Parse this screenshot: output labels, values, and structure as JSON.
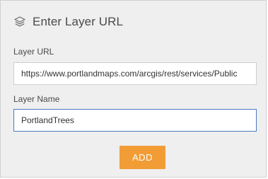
{
  "header": {
    "icon": "layers-icon",
    "title": "Enter Layer URL"
  },
  "form": {
    "url_label": "Layer URL",
    "url_value": "https://www.portlandmaps.com/arcgis/rest/services/Public",
    "name_label": "Layer Name",
    "name_value": "PortlandTrees"
  },
  "actions": {
    "add_label": "ADD"
  },
  "colors": {
    "panel_bg": "#efefef",
    "accent": "#f29c36",
    "focus_border": "#4a7bbd"
  }
}
